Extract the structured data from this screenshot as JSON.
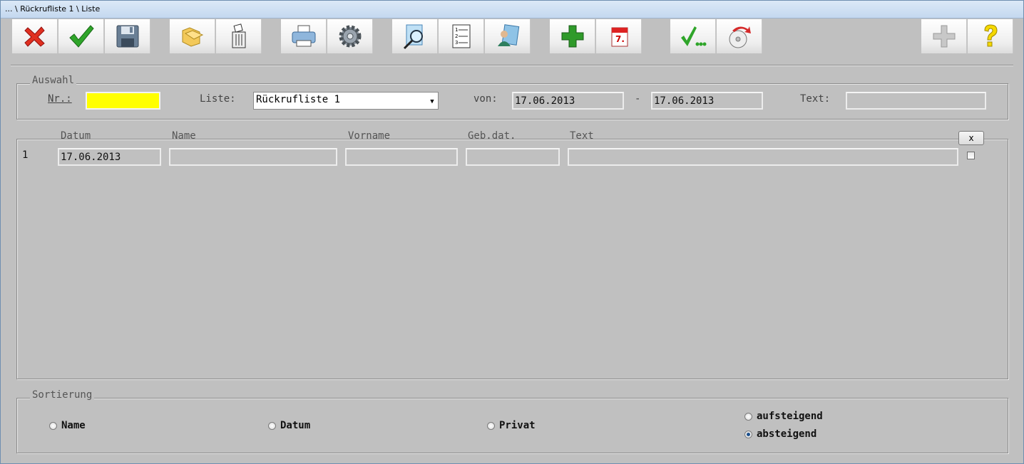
{
  "window": {
    "title": "... \\ Rückrufliste 1 \\ Liste"
  },
  "toolbar": {
    "buttons": [
      {
        "name": "cancel-button",
        "icon": "red-x-icon"
      },
      {
        "name": "ok-button",
        "icon": "green-check-icon"
      },
      {
        "name": "save-button",
        "icon": "floppy-disk-icon"
      },
      {
        "name": "open-folder-button",
        "icon": "folder-icon"
      },
      {
        "name": "delete-button",
        "icon": "trash-icon"
      },
      {
        "name": "print-button",
        "icon": "printer-icon"
      },
      {
        "name": "settings-button",
        "icon": "gear-icon"
      },
      {
        "name": "search-button",
        "icon": "magnifier-icon"
      },
      {
        "name": "numbered-list-button",
        "icon": "numbered-list-icon"
      },
      {
        "name": "patient-button",
        "icon": "person-icon"
      },
      {
        "name": "add-button",
        "icon": "green-plus-icon"
      },
      {
        "name": "calendar-button",
        "icon": "calendar-icon"
      },
      {
        "name": "check-more-button",
        "icon": "check-dots-icon"
      },
      {
        "name": "gdt-button",
        "icon": "gdt-disc-icon"
      },
      {
        "name": "add-disabled-button",
        "icon": "gray-plus-icon"
      },
      {
        "name": "help-button",
        "icon": "question-icon"
      }
    ]
  },
  "auswahl": {
    "legend": "Auswahl",
    "nr_label": "Nr.:",
    "nr_value": "",
    "liste_label": "Liste:",
    "liste_value": "Rückrufliste 1",
    "von_label": "von:",
    "von_value": "17.06.2013",
    "dash": "-",
    "bis_value": "17.06.2013",
    "text_label": "Text:",
    "text_value": ""
  },
  "table": {
    "columns": [
      "Datum",
      "Name",
      "Vorname",
      "Geb.dat.",
      "Text"
    ],
    "clear_label": "x",
    "rows": [
      {
        "index": "1",
        "datum": "17.06.2013",
        "name": "",
        "vorname": "",
        "gebdat": "",
        "text": ""
      }
    ]
  },
  "sortierung": {
    "legend": "Sortierung",
    "options": [
      "Name",
      "Datum",
      "Privat"
    ],
    "selected": "",
    "order_options": [
      "aufsteigend",
      "absteigend"
    ],
    "order_selected": "absteigend"
  },
  "colors": {
    "nr_highlight": "#ffff00",
    "background": "#c0c0c0"
  }
}
